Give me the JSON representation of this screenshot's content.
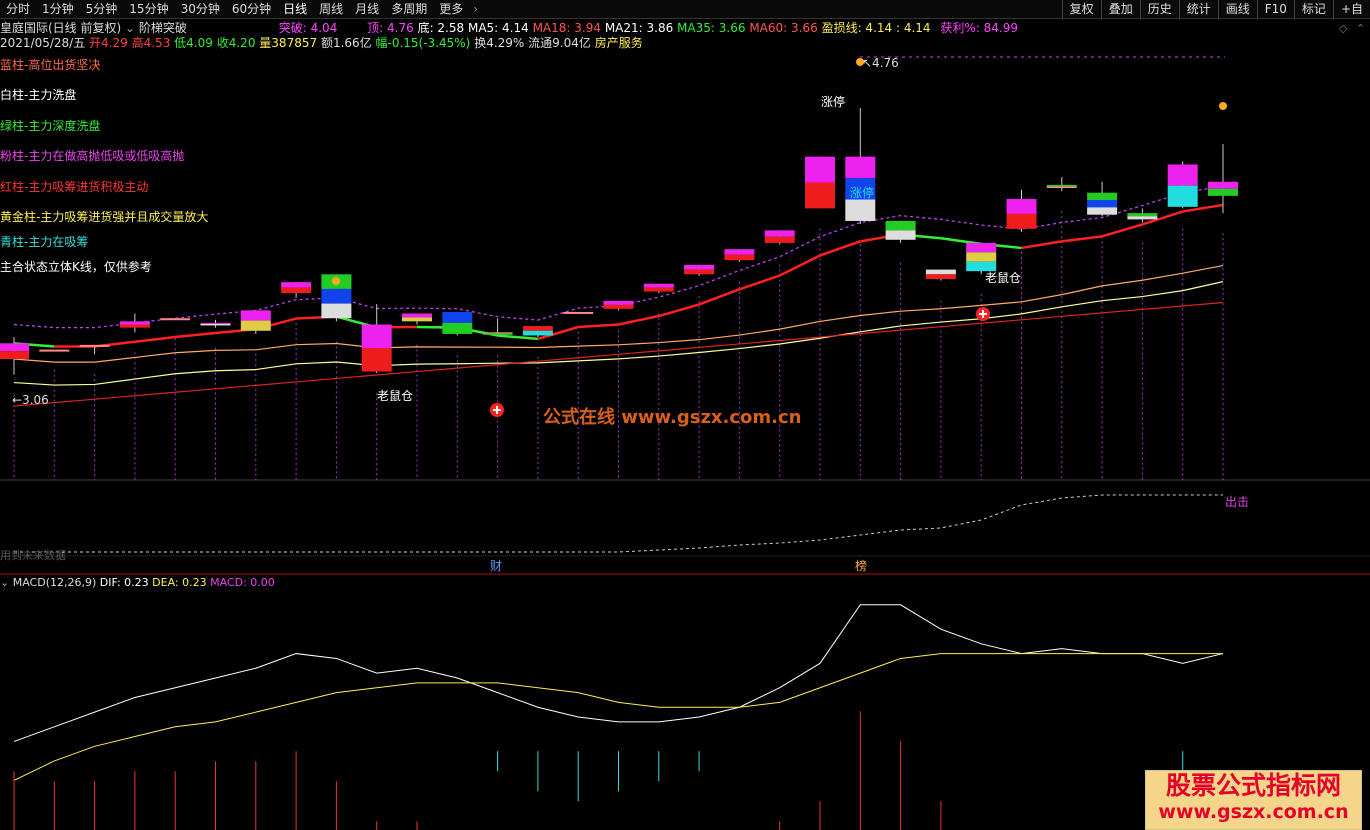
{
  "toolbar": {
    "tabs": [
      "分时",
      "1分钟",
      "5分钟",
      "15分钟",
      "30分钟",
      "60分钟",
      "日线",
      "周线",
      "月线",
      "多周期",
      "更多"
    ],
    "active_tab": "日线",
    "right_buttons": [
      "复权",
      "叠加",
      "历史",
      "统计",
      "画线",
      "F10",
      "标记",
      "+自"
    ]
  },
  "info": {
    "stock": "皇庭国际(日线 前复权)",
    "indicator": "阶梯突破",
    "break_label": "突破: 4.04",
    "top_label": "顶: 4.76",
    "bottom_label": "底: 2.58",
    "ma5": "MA5: 4.14",
    "ma18": "MA18: 3.94",
    "ma21": "MA21: 3.86",
    "ma35": "MA35: 3.66",
    "ma60": "MA60: 3.66",
    "profit_line": "盈损线: 4.14 : 4.14",
    "profit_pct": "获利%: 84.99",
    "date": "2021/05/28/五",
    "open": "开4.29",
    "high": "高4.53",
    "low": "低4.09",
    "close": "收4.20",
    "volume": "量387857",
    "amount": "额1.66亿",
    "change": "幅-0.15(-3.45%)",
    "turnover": "换4.29%",
    "float": "流通9.04亿",
    "sector": "房产服务"
  },
  "legend": [
    {
      "text": "蓝柱-高位出货坚决",
      "color": "#ff6a4d"
    },
    {
      "text": "白柱-主力洗盘",
      "color": "#ffffff"
    },
    {
      "text": "绿柱-主力深度洗盘",
      "color": "#33ee33"
    },
    {
      "text": "粉柱-主力在做高抛低吸或低吸高抛",
      "color": "#ee44ee"
    },
    {
      "text": "红柱-主力吸筹进货积极主动",
      "color": "#ff3333"
    },
    {
      "text": "黄金柱-主力吸筹进货强并且成交量放大",
      "color": "#ffee55"
    },
    {
      "text": "青柱-主力在吸筹",
      "color": "#33dddd"
    },
    {
      "text": "主合状态立体K线，仅供参考",
      "color": "#ffffff"
    }
  ],
  "annotations": {
    "price_low": "3.06",
    "price_high": "4.76",
    "zhangting": "涨停",
    "zhangting2": "涨停",
    "mouse_1": "老鼠仓",
    "mouse_2": "老鼠仓",
    "exit": "出击",
    "future_note": "用到未来数据",
    "cai": "财",
    "bang": "榜"
  },
  "watermark": "公式在线 www.gszx.com.cn",
  "badge": {
    "line1": "股票公式指标网",
    "line2": "www.gszx.com.cn"
  },
  "macd": {
    "title": "MACD(12,26,9)",
    "dif": "DIF: 0.23",
    "dea": "DEA: 0.23",
    "macd": "MACD: 0.00"
  },
  "colors": {
    "up": "#ff3030",
    "down": "#33ee33",
    "ma5": "#ff2020",
    "ma_yellow": "#ffff99",
    "ma_orange": "#ffaa66",
    "ma_red": "#dd2222",
    "purple_dash": "#cc44ff",
    "pink": "#ee22ee"
  },
  "chart_data": {
    "type": "candlestick",
    "title": "阶梯突破",
    "y_range": [
      2.58,
      4.76
    ],
    "candles": [
      {
        "o": 3.16,
        "h": 3.3,
        "l": 3.06,
        "c": 3.26,
        "color": "pink-red"
      },
      {
        "o": 3.22,
        "h": 3.22,
        "l": 3.22,
        "c": 3.22,
        "color": "doji"
      },
      {
        "o": 3.25,
        "h": 3.25,
        "l": 3.19,
        "c": 3.24,
        "color": "doji"
      },
      {
        "o": 3.4,
        "h": 3.45,
        "l": 3.33,
        "c": 3.36,
        "color": "pink-red"
      },
      {
        "o": 3.42,
        "h": 3.42,
        "l": 3.42,
        "c": 3.42,
        "color": "doji"
      },
      {
        "o": 3.38,
        "h": 3.41,
        "l": 3.36,
        "c": 3.39,
        "color": "pink-white"
      },
      {
        "o": 3.47,
        "h": 3.47,
        "l": 3.32,
        "c": 3.34,
        "color": "pink-gold"
      },
      {
        "o": 3.65,
        "h": 3.65,
        "l": 3.55,
        "c": 3.58,
        "color": "pink-red"
      },
      {
        "o": 3.7,
        "h": 3.7,
        "l": 3.4,
        "c": 3.42,
        "color": "green-blue-white"
      },
      {
        "o": 3.38,
        "h": 3.51,
        "l": 3.07,
        "c": 3.08,
        "color": "pink-red"
      },
      {
        "o": 3.45,
        "h": 3.45,
        "l": 3.38,
        "c": 3.4,
        "color": "pink-gold"
      },
      {
        "o": 3.46,
        "h": 3.46,
        "l": 3.31,
        "c": 3.32,
        "color": "blue-green"
      },
      {
        "o": 3.33,
        "h": 3.42,
        "l": 3.31,
        "c": 3.33,
        "color": "doji-green"
      },
      {
        "o": 3.37,
        "h": 3.37,
        "l": 3.3,
        "c": 3.31,
        "color": "red-cyan"
      },
      {
        "o": 3.46,
        "h": 3.46,
        "l": 3.46,
        "c": 3.46,
        "color": "doji"
      },
      {
        "o": 3.53,
        "h": 3.53,
        "l": 3.47,
        "c": 3.48,
        "color": "pink-red"
      },
      {
        "o": 3.64,
        "h": 3.64,
        "l": 3.58,
        "c": 3.59,
        "color": "pink-red"
      },
      {
        "o": 3.76,
        "h": 3.76,
        "l": 3.69,
        "c": 3.7,
        "color": "pink-red"
      },
      {
        "o": 3.86,
        "h": 3.86,
        "l": 3.78,
        "c": 3.79,
        "color": "pink-red"
      },
      {
        "o": 3.98,
        "h": 3.98,
        "l": 3.89,
        "c": 3.9,
        "color": "pink-red"
      },
      {
        "o": 4.45,
        "h": 4.45,
        "l": 4.12,
        "c": 4.12,
        "color": "pink-red"
      },
      {
        "o": 4.45,
        "h": 4.76,
        "l": 4.02,
        "c": 4.04,
        "color": "pink-blue-white"
      },
      {
        "o": 4.04,
        "h": 4.04,
        "l": 3.9,
        "c": 3.92,
        "color": "green-white"
      },
      {
        "o": 3.73,
        "h": 3.73,
        "l": 3.66,
        "c": 3.67,
        "color": "white-red"
      },
      {
        "o": 3.9,
        "h": 3.9,
        "l": 3.7,
        "c": 3.72,
        "color": "pink-gold-cyan"
      },
      {
        "o": 4.18,
        "h": 4.24,
        "l": 3.97,
        "c": 3.99,
        "color": "pink-red"
      },
      {
        "o": 4.27,
        "h": 4.32,
        "l": 4.23,
        "c": 4.25,
        "color": "green-doji"
      },
      {
        "o": 4.22,
        "h": 4.29,
        "l": 4.07,
        "c": 4.08,
        "color": "green-blue-white"
      },
      {
        "o": 4.09,
        "h": 4.12,
        "l": 4.03,
        "c": 4.05,
        "color": "green-white"
      },
      {
        "o": 4.4,
        "h": 4.42,
        "l": 4.12,
        "c": 4.13,
        "color": "pink-cyan"
      },
      {
        "o": 4.29,
        "h": 4.53,
        "l": 4.09,
        "c": 4.2,
        "color": "pink-green"
      }
    ],
    "macd_dif": [
      0.02,
      0.05,
      0.08,
      0.11,
      0.13,
      0.15,
      0.17,
      0.2,
      0.19,
      0.16,
      0.17,
      0.15,
      0.12,
      0.09,
      0.07,
      0.06,
      0.06,
      0.07,
      0.09,
      0.13,
      0.18,
      0.3,
      0.3,
      0.25,
      0.22,
      0.2,
      0.21,
      0.2,
      0.2,
      0.18,
      0.2
    ],
    "macd_dea": [
      -0.06,
      -0.02,
      0.01,
      0.03,
      0.05,
      0.06,
      0.08,
      0.1,
      0.12,
      0.13,
      0.14,
      0.14,
      0.14,
      0.13,
      0.12,
      0.1,
      0.09,
      0.09,
      0.09,
      0.1,
      0.13,
      0.16,
      0.19,
      0.2,
      0.2,
      0.2,
      0.2,
      0.2,
      0.2,
      0.2,
      0.2
    ]
  }
}
